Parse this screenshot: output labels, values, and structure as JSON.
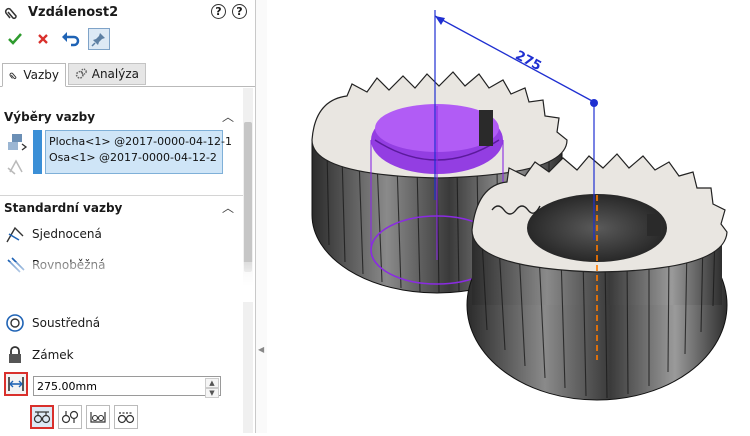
{
  "panel": {
    "title": "Vzdálenost2",
    "help_symbol": "?",
    "tabs": [
      {
        "label": "Vazby"
      },
      {
        "label": "Analýza"
      }
    ],
    "selections_section": {
      "title": "Výběry vazby",
      "items": [
        "Plocha<1> @2017-0000-04-12-1",
        "Osa<1> @2017-0000-04-12-2"
      ]
    },
    "standard_section": {
      "title": "Standardní vazby",
      "items": [
        {
          "label": "Sjednocená",
          "icon": "coincident-icon"
        },
        {
          "label": "Rovnoběžná",
          "icon": "parallel-icon"
        },
        {
          "label": "Soustředná",
          "icon": "concentric-icon"
        },
        {
          "label": "Zámek",
          "icon": "lock-icon"
        }
      ]
    },
    "distance": {
      "value": "275.00mm"
    }
  },
  "viewport": {
    "dimension_label": "275",
    "dimension_color": "#1f2fd1",
    "highlight_color": "#8a2be2",
    "axis_color": "#ff7a00"
  },
  "colors": {
    "accent_red": "#d9302c",
    "selection_blue": "#cfe5f7",
    "check_green": "#2e9b2e"
  }
}
